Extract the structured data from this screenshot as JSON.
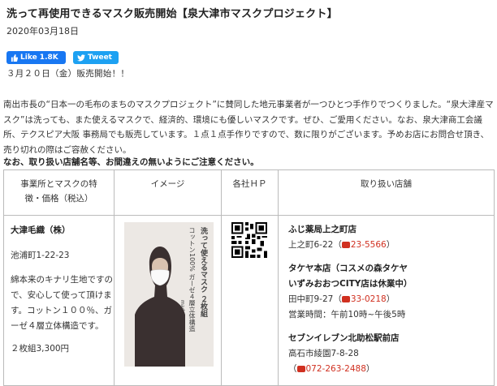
{
  "article": {
    "title": "洗って再使用できるマスク販売開始【泉大津市マスクプロジェクト】",
    "date": "2020年03月18日",
    "sale_start": "３月２０日（金）販売開始！！",
    "body": "南出市長の“日本一の毛布のまちのマスクプロジェクト”に賛同した地元事業者が一つひとつ手作りでつくりました。“泉大津産マスク”は洗っても、また使えるマスクで、経済的、環境にも優しいマスクです。ぜひ、ご愛用ください。なお、泉大津商工会議所、テクスピア大阪 事務局でも販売しています。１点１点手作りですので、数に限りがございます。予めお店にお問合せ頂き、売り切れの際はご容赦ください。",
    "notice": "なお、取り扱い店舗名等、お間違えの無いようにご注意ください。"
  },
  "share": {
    "like_label": "Like 1.8K",
    "tweet_label": "Tweet",
    "like_color": "#1877f2",
    "tweet_color": "#1da1f2"
  },
  "table": {
    "headers": [
      "事業所とマスクの特徴・価格（税込）",
      "イメージ",
      "各社ＨＰ",
      "取り扱い店舗"
    ],
    "row": {
      "company": "大津毛織（株）",
      "address": "池浦町1-22-23",
      "description": "綿本来のキナリ生地ですので、安心して使って頂けます。コットン１００％、ガーゼ４層立体構造です。",
      "price": "２枚組3,300円",
      "image_text": {
        "line1": "洗って使えるマスク ２枚組",
        "line2": "コットン100% ガーゼ４層立体構造",
        "line3": "made in japan"
      },
      "stores": [
        {
          "name": "ふじ薬局上之町店",
          "address": "上之町6-22",
          "tel": "23-5566"
        },
        {
          "name": "タケヤ本店（コスメの森タケヤ",
          "name2": "いずみおおつCITY店は休業中）",
          "address": "田中町9-27",
          "tel": "33-0218",
          "hours": "営業時間：午前10時~午後5時"
        },
        {
          "name": "セブンイレブン北助松駅前店",
          "address": "高石市綾園7-8-28",
          "tel": "072-263-2488"
        }
      ]
    }
  }
}
